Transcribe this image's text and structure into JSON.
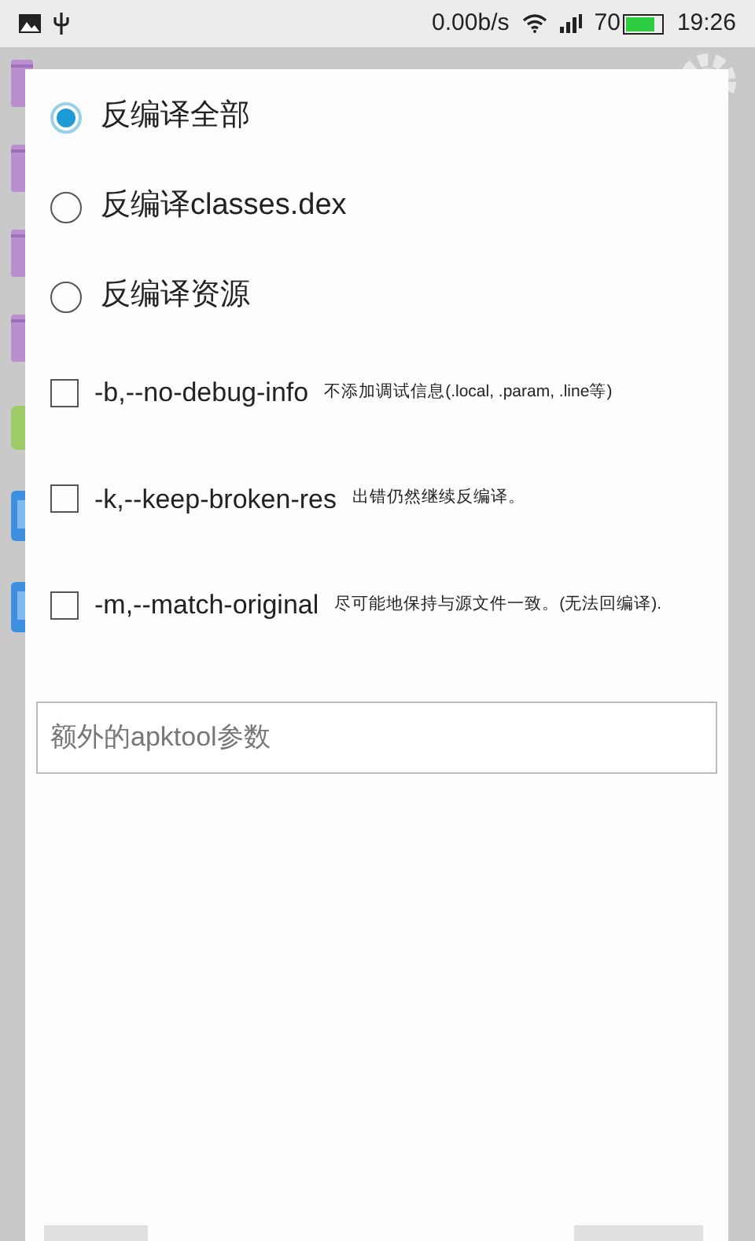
{
  "status_bar": {
    "net_speed": "0.00b/s",
    "battery": "70",
    "time": "19:26"
  },
  "background_list": [
    {
      "kind": "folder"
    },
    {
      "kind": "folder"
    },
    {
      "kind": "folder"
    },
    {
      "kind": "folder"
    },
    {
      "kind": "android"
    },
    {
      "kind": "apk"
    },
    {
      "kind": "apk"
    }
  ],
  "modes": [
    {
      "label": "反编译全部",
      "selected": true
    },
    {
      "label": "反编译classes.dex",
      "selected": false
    },
    {
      "label": "反编译资源",
      "selected": false
    }
  ],
  "flags": [
    {
      "flag": "-b,--no-debug-info",
      "description": "不添加调试信息(.local, .param, .line等)",
      "checked": false
    },
    {
      "flag": "-k,--keep-broken-res",
      "description": "出错仍然继续反编译。",
      "checked": false
    },
    {
      "flag": "-m,--match-original",
      "description": "尽可能地保持与源文件一致。(无法回编译).",
      "checked": false
    }
  ],
  "extra_args": {
    "placeholder": "额外的apktool参数"
  }
}
